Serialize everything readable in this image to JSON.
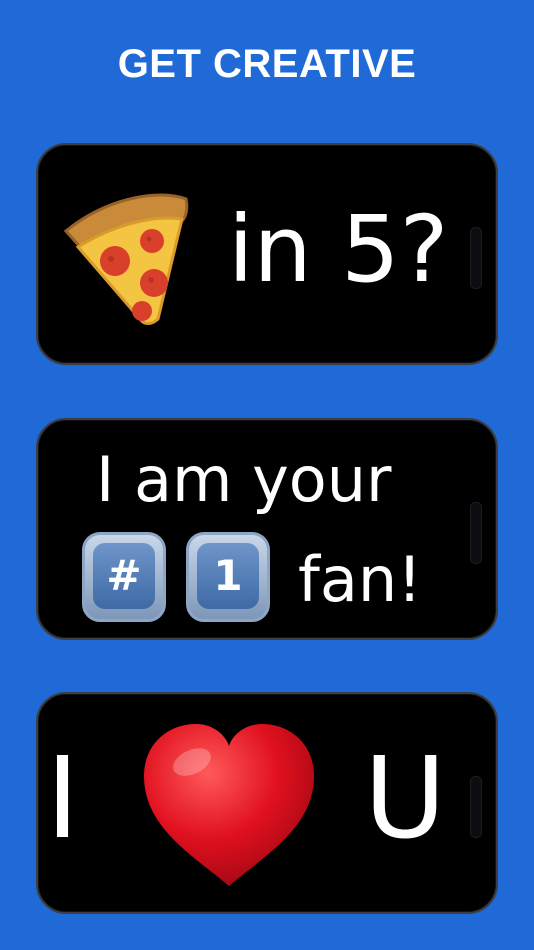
{
  "headline": "GET CREATIVE",
  "panels": [
    {
      "icon": "pizza-icon",
      "text": "in 5?"
    },
    {
      "line1": "I am your",
      "keys": [
        "#",
        "1"
      ],
      "keycap_icons": [
        "keycap-hash-icon",
        "keycap-one-icon"
      ],
      "line2": "fan!"
    },
    {
      "left": "I",
      "icon": "heart-icon",
      "right": "U"
    }
  ],
  "colors": {
    "background": "#1f6ad6",
    "phone_screen": "#000000",
    "text": "#ffffff",
    "heart": "#e0101e",
    "keycap": "#4f7bb7"
  }
}
